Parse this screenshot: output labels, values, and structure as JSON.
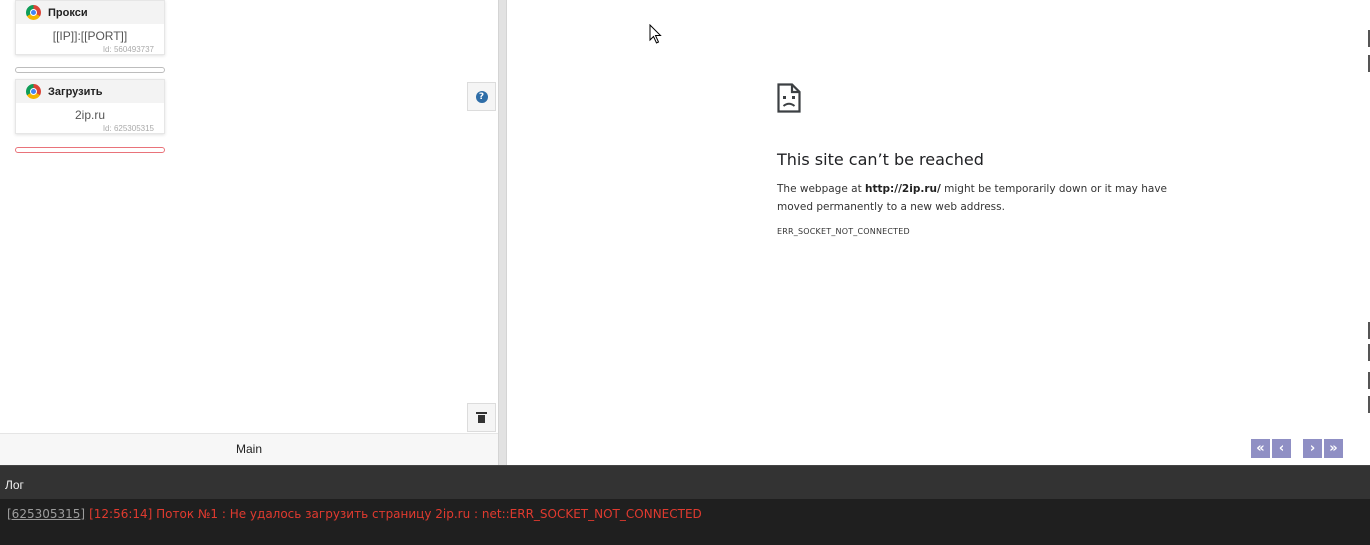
{
  "blocks": [
    {
      "title": "Прокси",
      "value": "[[IP]]:[[PORT]]",
      "id_text": "Id: 560493737"
    },
    {
      "title": "Загрузить",
      "value": "2ip.ru",
      "id_text": "Id: 625305315"
    }
  ],
  "tabs": {
    "main": "Main"
  },
  "browser": {
    "error_title": "This site can’t be reached",
    "desc_before": "The webpage at ",
    "url": "http://2ip.ru/",
    "desc_after": " might be temporarily down or it may have moved permanently to a new web address.",
    "error_code": "ERR_SOCKET_NOT_CONNECTED"
  },
  "colors": {
    "nav_button": "#8f8fc4",
    "log_error": "#e03a2f",
    "log_background": "#1f1f1f"
  },
  "icons": {
    "help": "question-circle-icon",
    "delete": "trash-icon",
    "browser": "chrome-icon",
    "page_error": "sad-document-icon"
  },
  "log": {
    "title": "Лог",
    "entries": [
      {
        "id": "[625305315]",
        "message": "[12:56:14] Поток №1 : Не удалось загрузить страницу 2ip.ru : net::ERR_SOCKET_NOT_CONNECTED"
      }
    ]
  }
}
